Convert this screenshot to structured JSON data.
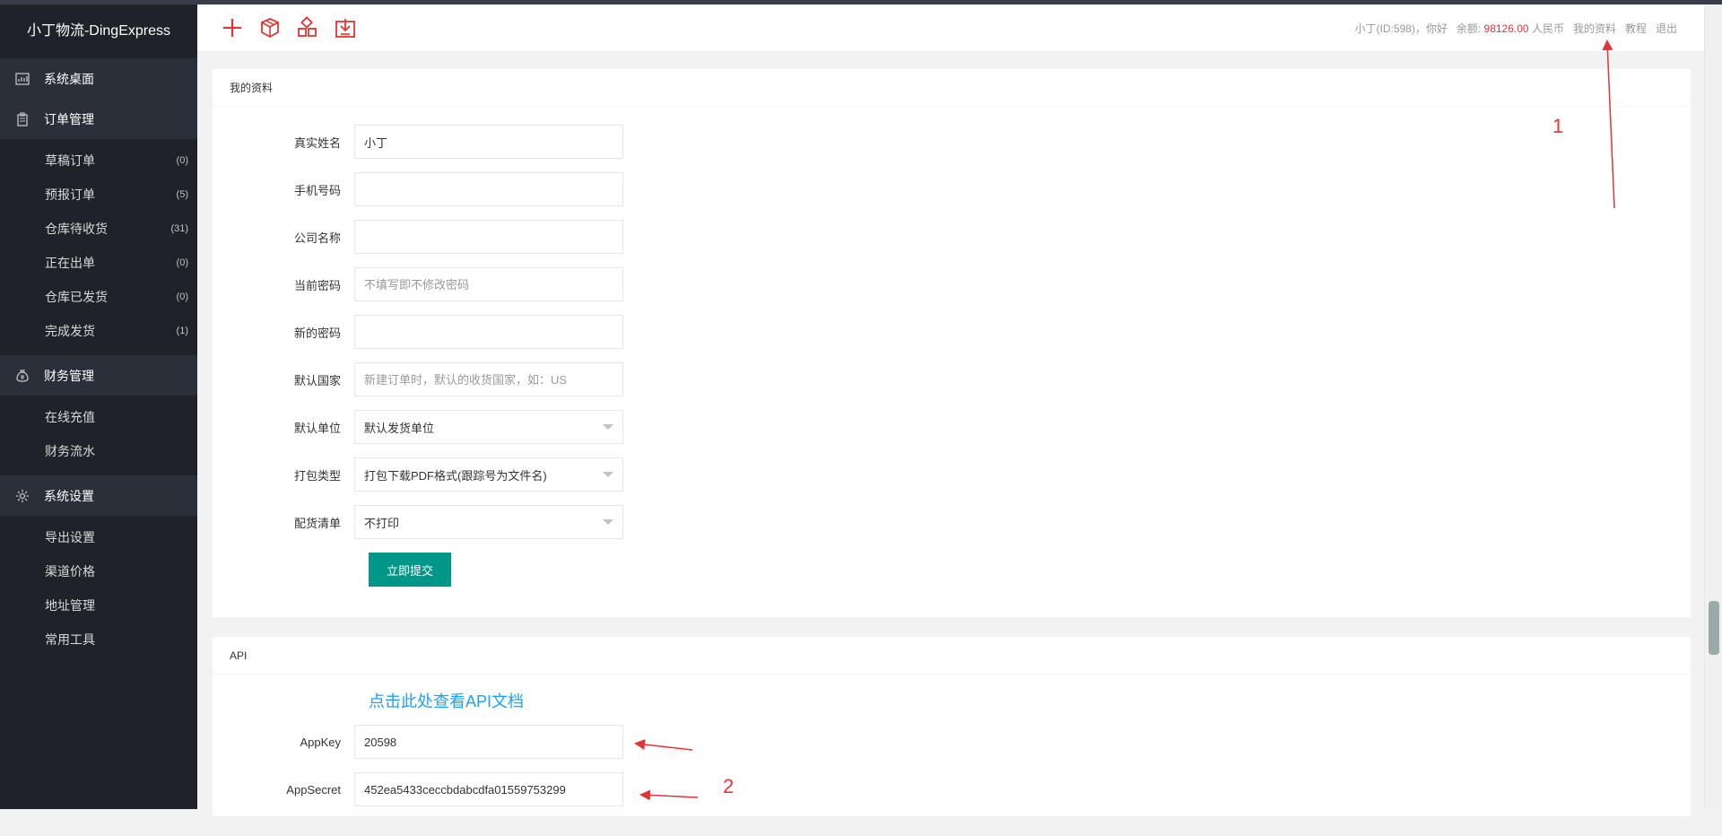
{
  "sidebar": {
    "logo": "小丁物流-DingExpress",
    "groups": [
      {
        "label": "系统桌面",
        "icon": "dashboard-icon",
        "items": []
      },
      {
        "label": "订单管理",
        "icon": "clipboard-icon",
        "items": [
          {
            "label": "草稿订单",
            "count": "(0)"
          },
          {
            "label": "预报订单",
            "count": "(5)"
          },
          {
            "label": "仓库待收货",
            "count": "(31)"
          },
          {
            "label": "正在出单",
            "count": "(0)"
          },
          {
            "label": "仓库已发货",
            "count": "(0)"
          },
          {
            "label": "完成发货",
            "count": "(1)"
          }
        ]
      },
      {
        "label": "财务管理",
        "icon": "money-bag-icon",
        "items": [
          {
            "label": "在线充值"
          },
          {
            "label": "财务流水"
          }
        ]
      },
      {
        "label": "系统设置",
        "icon": "gear-icon",
        "items": [
          {
            "label": "导出设置"
          },
          {
            "label": "渠道价格"
          },
          {
            "label": "地址管理"
          },
          {
            "label": "常用工具"
          }
        ]
      }
    ]
  },
  "header": {
    "toolbar_icons": [
      "add-icon",
      "package-icon",
      "grid-icon",
      "download-icon"
    ],
    "user_greeting": "小丁(ID:598)，你好",
    "balance_label": "余额:",
    "balance_value": "98126.00",
    "currency": "人民币",
    "links": [
      "我的资料",
      "教程",
      "退出"
    ]
  },
  "profile": {
    "title": "我的资料",
    "fields": [
      {
        "label": "真实姓名",
        "value": "小丁",
        "placeholder": ""
      },
      {
        "label": "手机号码",
        "value": "",
        "placeholder": ""
      },
      {
        "label": "公司名称",
        "value": "",
        "placeholder": ""
      },
      {
        "label": "当前密码",
        "value": "",
        "placeholder": "不填写即不修改密码"
      },
      {
        "label": "新的密码",
        "value": "",
        "placeholder": ""
      },
      {
        "label": "默认国家",
        "value": "",
        "placeholder": "新建订单时，默认的收货国家，如：US"
      }
    ],
    "selects": [
      {
        "label": "默认单位",
        "value": "默认发货单位"
      },
      {
        "label": "打包类型",
        "value": "打包下载PDF格式(跟踪号为文件名)"
      },
      {
        "label": "配货清单",
        "value": "不打印"
      }
    ],
    "submit_label": "立即提交"
  },
  "api": {
    "title": "API",
    "doc_link": "点击此处查看API文档",
    "appkey_label": "AppKey",
    "appkey_value": "20598",
    "appsecret_label": "AppSecret",
    "appsecret_value": "452ea5433ceccbdabcdfa01559753299"
  },
  "annotations": {
    "label_1": "1",
    "label_2": "2",
    "color": "#e33333"
  },
  "colors": {
    "sidebar_bg": "#20222A",
    "accent_green": "#009688",
    "link_blue": "#1E9FFF",
    "toolbar_red": "#e33333"
  }
}
